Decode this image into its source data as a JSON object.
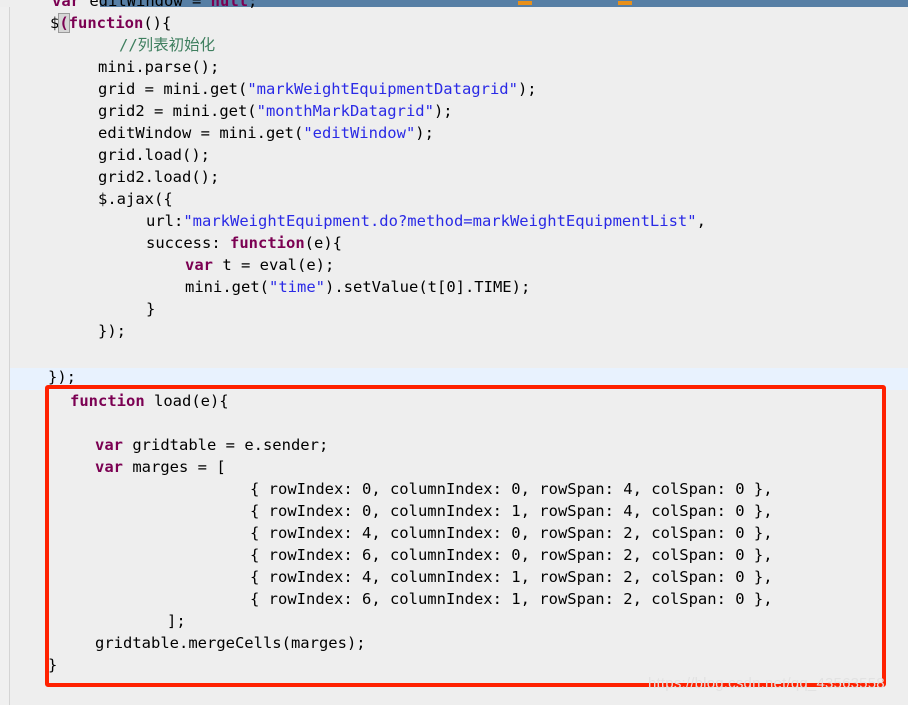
{
  "window": {
    "chrome_bar_color": "#577fa5",
    "accent_marker_color": "#e8901b"
  },
  "annotation": {
    "box_color": "#ff2100",
    "box_label": "highlighted-code-region"
  },
  "watermark": {
    "text": "https://blog.csdn.net/qq_43563558"
  },
  "editor": {
    "background": "#eeeeee",
    "caret_line_background": "#e8f2fe",
    "theme_colors": {
      "keyword": "#7b0052",
      "string": "#2a2ae6",
      "comment": "#3f7f5f",
      "plain": "#000000"
    }
  },
  "code": {
    "language": "javascript",
    "lines": [
      {
        "indent": 3,
        "text": "var editWindow = null;"
      },
      {
        "indent": 3,
        "text": "$(function(){"
      },
      {
        "indent": 6,
        "text": "//列表初始化"
      },
      {
        "indent": 6,
        "text": "mini.parse();"
      },
      {
        "indent": 6,
        "text": "grid = mini.get(\"markWeightEquipmentDatagrid\");"
      },
      {
        "indent": 6,
        "text": "grid2 = mini.get(\"monthMarkDatagrid\");"
      },
      {
        "indent": 6,
        "text": "editWindow = mini.get(\"editWindow\");"
      },
      {
        "indent": 6,
        "text": "grid.load();"
      },
      {
        "indent": 6,
        "text": "grid2.load();"
      },
      {
        "indent": 6,
        "text": "$.ajax({"
      },
      {
        "indent": 9,
        "text": "url:\"markWeightEquipment.do?method=markWeightEquipmentList\","
      },
      {
        "indent": 9,
        "text": "success: function(e){"
      },
      {
        "indent": 12,
        "text": "var t = eval(e);"
      },
      {
        "indent": 12,
        "text": "mini.get(\"time\").setValue(t[0].TIME);"
      },
      {
        "indent": 9,
        "text": "}"
      },
      {
        "indent": 6,
        "text": "});"
      },
      {
        "indent": 0,
        "text": ""
      },
      {
        "indent": 3,
        "text": "});"
      },
      {
        "indent": 4,
        "text": "function load(e){"
      },
      {
        "indent": 0,
        "text": ""
      },
      {
        "indent": 6,
        "text": "var gridtable = e.sender;"
      },
      {
        "indent": 6,
        "text": "var marges = ["
      },
      {
        "indent": 17,
        "text": "{ rowIndex: 0, columnIndex: 0, rowSpan: 4, colSpan: 0 },"
      },
      {
        "indent": 17,
        "text": "{ rowIndex: 0, columnIndex: 1, rowSpan: 4, colSpan: 0 },"
      },
      {
        "indent": 17,
        "text": "{ rowIndex: 4, columnIndex: 0, rowSpan: 2, colSpan: 0 },"
      },
      {
        "indent": 17,
        "text": "{ rowIndex: 6, columnIndex: 0, rowSpan: 2, colSpan: 0 },"
      },
      {
        "indent": 17,
        "text": "{ rowIndex: 4, columnIndex: 1, rowSpan: 2, colSpan: 0 },"
      },
      {
        "indent": 17,
        "text": "{ rowIndex: 6, columnIndex: 1, rowSpan: 2, colSpan: 0 },"
      },
      {
        "indent": 11,
        "text": "];"
      },
      {
        "indent": 6,
        "text": "gridtable.mergeCells(marges);"
      },
      {
        "indent": 3,
        "text": "}"
      }
    ],
    "rendered": {
      "l01_pre": "var",
      "l01_rest": " editWindow = ",
      "l01_null": "null",
      "l01_end": ";",
      "l02_dollar": "$",
      "l02_paren": "(",
      "l02_fn": "function",
      "l02_end": "(){",
      "l03_comment": "//列表初始化",
      "l04": "mini.parse();",
      "l05_a": "grid = mini.get(",
      "l05_s": "\"markWeightEquipmentDatagrid\"",
      "l05_b": ");",
      "l06_a": "grid2 = mini.get(",
      "l06_s": "\"monthMarkDatagrid\"",
      "l06_b": ");",
      "l07_a": "editWindow = mini.get(",
      "l07_s": "\"editWindow\"",
      "l07_b": ");",
      "l08": "grid.load();",
      "l09": "grid2.load();",
      "l10": "$.ajax({",
      "l11_a": "url:",
      "l11_s": "\"markWeightEquipment.do?method=markWeightEquipmentList\"",
      "l11_b": ",",
      "l12_a": "success: ",
      "l12_kw": "function",
      "l12_b": "(e){",
      "l13_kw": "var",
      "l13_b": " t = eval(e);",
      "l14_a": "mini.get(",
      "l14_s": "\"time\"",
      "l14_b": ").setValue(t[0].TIME);",
      "l15": "}",
      "l16": "});",
      "l18": "});",
      "l19_kw": "function",
      "l19_b": " load(e){",
      "l21_kw": "var",
      "l21_b": " gridtable = e.sender;",
      "l22_kw": "var",
      "l22_b": " marges = [",
      "l23": "{ rowIndex: 0, columnIndex: 0, rowSpan: 4, colSpan: 0 },",
      "l24": "{ rowIndex: 0, columnIndex: 1, rowSpan: 4, colSpan: 0 },",
      "l25": "{ rowIndex: 4, columnIndex: 0, rowSpan: 2, colSpan: 0 },",
      "l26": "{ rowIndex: 6, columnIndex: 0, rowSpan: 2, colSpan: 0 },",
      "l27": "{ rowIndex: 4, columnIndex: 1, rowSpan: 2, colSpan: 0 },",
      "l28": "{ rowIndex: 6, columnIndex: 1, rowSpan: 2, colSpan: 0 },",
      "l29": "];",
      "l30": "gridtable.mergeCells(marges);",
      "l31": "}"
    }
  }
}
